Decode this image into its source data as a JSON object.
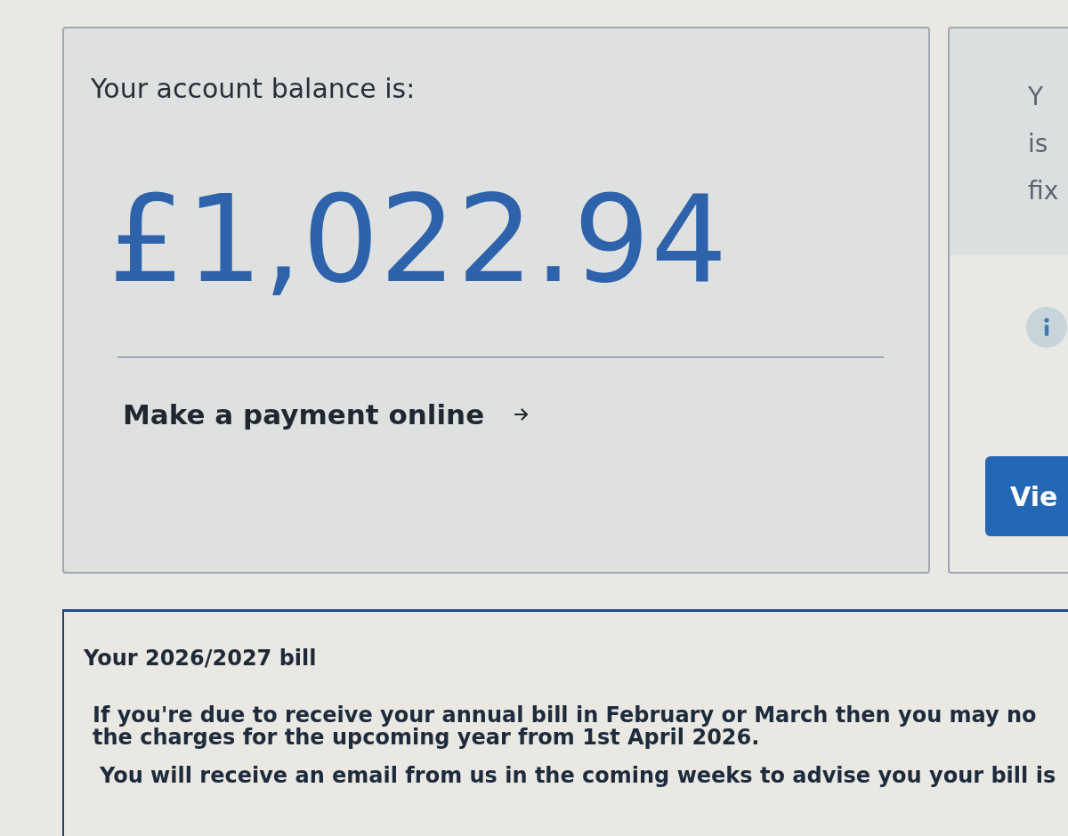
{
  "balance_card": {
    "label": "Your account balance is:",
    "amount": "£1,022.94",
    "payment_link": {
      "label": "Make a payment online"
    }
  },
  "side_card": {
    "lines": [
      "Y",
      "is",
      "fix"
    ],
    "button": "Vie"
  },
  "bill_notice": {
    "title": "Your 2026/2027 bill",
    "paragraphs": [
      {
        "lines": [
          "If you're due to receive your annual bill in February or March then you may no",
          "the charges for the upcoming year from 1st April 2026."
        ]
      },
      {
        "lines": [
          "You will receive an email from us in the coming weeks to advise you your bill is"
        ]
      }
    ]
  }
}
